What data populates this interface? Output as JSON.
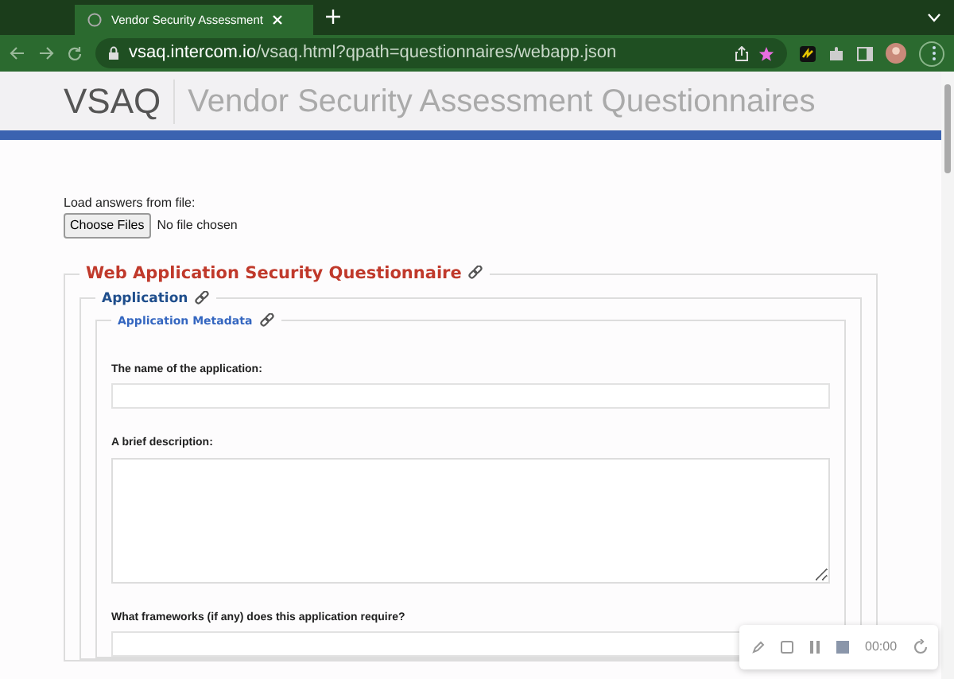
{
  "browser": {
    "tab_title": "Vendor Security Assessment",
    "url_host": "vsaq.intercom.io",
    "url_path": "/vsaq.html?qpath=questionnaires/webapp.json"
  },
  "header": {
    "logo": "VSAQ",
    "title": "Vendor Security Assessment Questionnaires"
  },
  "file_loader": {
    "label": "Load answers from file:",
    "button": "Choose Files",
    "status": "No file chosen"
  },
  "questionnaire": {
    "title": "Web Application Security Questionnaire",
    "section": {
      "title": "Application",
      "subsection": {
        "title": "Application Metadata",
        "questions": [
          {
            "kind": "line",
            "label": "The name of the application:"
          },
          {
            "kind": "textarea",
            "label": "A brief description:"
          },
          {
            "kind": "line",
            "label": "What frameworks (if any) does this application require?"
          }
        ]
      }
    }
  },
  "recorder": {
    "time": "00:00"
  }
}
